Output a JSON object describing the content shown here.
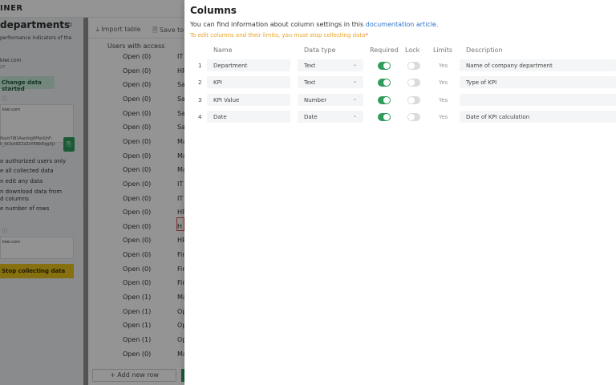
{
  "background": {
    "brand": "INER",
    "left": {
      "title": "departments",
      "copy_icon": "copy-icon",
      "description": "performance indicators of the",
      "email": "kiwi.com",
      "email_sub": "27",
      "change_button": "Change data started",
      "box1_email": "kiwi.com",
      "token": "0oyh7iB1Aanhlg9FAoXjhF-k_bCbxi9Z2xZsY8l6kEqgXjc",
      "options": [
        "o authorized users only",
        "e all collected data",
        "n edit any data",
        "n download data from",
        "d columns",
        "e number of rows"
      ],
      "box2_email": "kiwi.com",
      "stop_button": "Stop collecting data"
    },
    "table": {
      "toolbar": [
        "Import table",
        "Save to E"
      ],
      "column_header": "Users with access",
      "rows": [
        {
          "status": "Open (0)",
          "dept": "IT"
        },
        {
          "status": "Open (0)",
          "dept": "HR"
        },
        {
          "status": "Open (0)",
          "dept": "Sa"
        },
        {
          "status": "Open (0)",
          "dept": "Sa"
        },
        {
          "status": "Open (0)",
          "dept": "Sa"
        },
        {
          "status": "Open (0)",
          "dept": "Sa"
        },
        {
          "status": "Open (0)",
          "dept": "Ma"
        },
        {
          "status": "Open (0)",
          "dept": "Ma"
        },
        {
          "status": "Open (0)",
          "dept": "Ma"
        },
        {
          "status": "Open (0)",
          "dept": "IT"
        },
        {
          "status": "Open (0)",
          "dept": "IT"
        },
        {
          "status": "Open (0)",
          "dept": "HR"
        },
        {
          "status": "Open (0)",
          "dept": "H"
        },
        {
          "status": "Open (0)",
          "dept": "HR"
        },
        {
          "status": "Open (0)",
          "dept": "Fir"
        },
        {
          "status": "Open (0)",
          "dept": "Fir"
        },
        {
          "status": "Open (0)",
          "dept": "Fir"
        },
        {
          "status": "Open (1)",
          "dept": "Ma"
        },
        {
          "status": "Open (1)",
          "dept": "Op"
        },
        {
          "status": "Open (1)",
          "dept": "Op"
        },
        {
          "status": "Open (1)",
          "dept": "Op"
        },
        {
          "status": "Open (0)",
          "dept": "Ma"
        }
      ],
      "add_row": "+ Add new row"
    }
  },
  "modal": {
    "title": "Columns",
    "info_text": "You can find information about column settings in this ",
    "info_link": "documentation article.",
    "warning": "To edit columns and their limits, you must stop collecting data",
    "warning_star": "*",
    "headers": {
      "name": "Name",
      "type": "Data type",
      "required": "Required",
      "lock": "Lock",
      "limits": "Limits",
      "description": "Description"
    },
    "rows": [
      {
        "num": "1",
        "name": "Department",
        "type": "Text",
        "required": true,
        "lock": false,
        "limits": "Yes",
        "description": "Name of company department"
      },
      {
        "num": "2",
        "name": "KPI",
        "type": "Text",
        "required": true,
        "lock": false,
        "limits": "Yes",
        "description": "Type of KPI"
      },
      {
        "num": "3",
        "name": "KPI Value",
        "type": "Number",
        "required": true,
        "lock": false,
        "limits": "Yes",
        "description": ""
      },
      {
        "num": "4",
        "name": "Date",
        "type": "Date",
        "required": true,
        "lock": false,
        "limits": "Yes",
        "description": "Date of KPI calculation"
      }
    ],
    "colors": {
      "accent_green": "#2e9d5c",
      "link_blue": "#2f74c7",
      "warning_orange": "#e8a324"
    }
  }
}
